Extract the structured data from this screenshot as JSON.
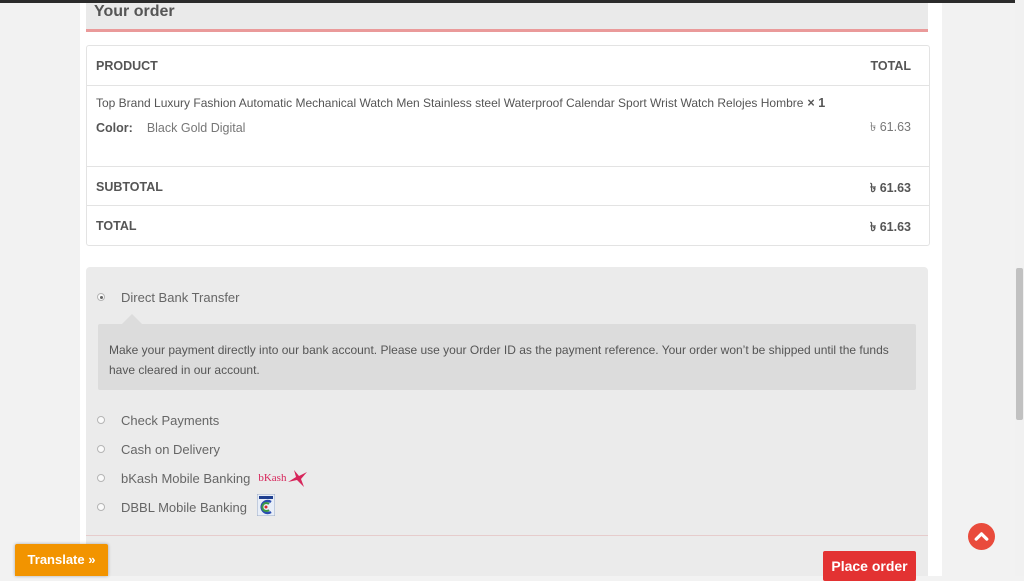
{
  "order": {
    "heading": "Your order",
    "columns": {
      "product": "PRODUCT",
      "total": "TOTAL"
    },
    "item": {
      "name": "Top Brand Luxury Fashion Automatic Mechanical Watch Men Stainless steel Waterproof Calendar Sport Wrist Watch Relojes Hombre",
      "quantity": "× 1",
      "color_label": "Color:",
      "color_value": "Black Gold Digital",
      "total": "৳ 61.63"
    },
    "subtotal": {
      "label": "SUBTOTAL",
      "value": "৳ 61.63"
    },
    "total": {
      "label": "TOTAL",
      "value": "৳ 61.63"
    }
  },
  "payment": {
    "selected": "Direct Bank Transfer",
    "methods": [
      {
        "label": "Direct Bank Transfer",
        "checked": true
      },
      {
        "label": "Check Payments",
        "checked": false
      },
      {
        "label": "Cash on Delivery",
        "checked": false
      },
      {
        "label": "bKash Mobile Banking",
        "checked": false,
        "logo": "bKash"
      },
      {
        "label": "DBBL Mobile Banking",
        "checked": false,
        "logo": "dbbl-logo-icon"
      }
    ],
    "description": "Make your payment directly into our bank account. Please use your Order ID as the payment reference. Your order won’t be shipped until the funds have cleared in our account.",
    "place_order_label": "Place order"
  },
  "translate_label": "Translate »",
  "colors": {
    "accent_red": "#e33232",
    "translate_orange": "#f29400",
    "header_underline": "#ea9a9a",
    "bkash_pink": "#d7265b"
  }
}
